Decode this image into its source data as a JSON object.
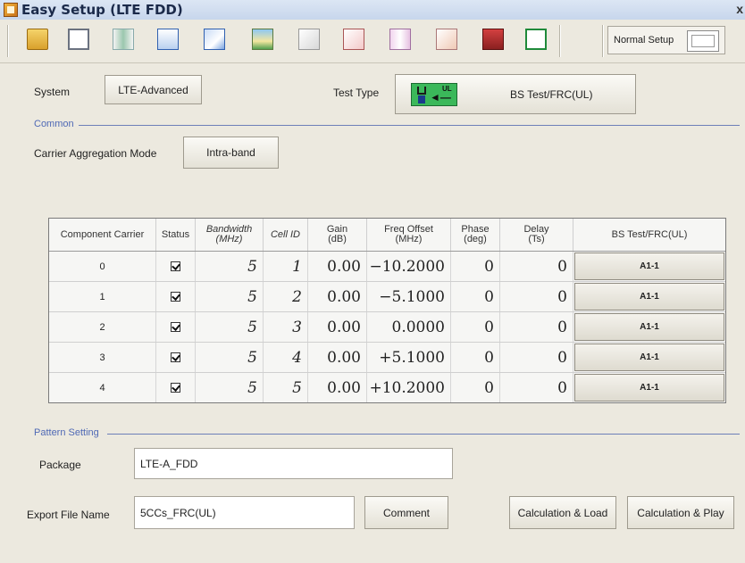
{
  "window": {
    "title": "Easy Setup (LTE FDD)",
    "close": "x"
  },
  "toolbar": {
    "icons": [
      "open-folder-icon",
      "save-icon",
      "waveform-icon",
      "export-icon",
      "load-play-icon",
      "landscape-icon",
      "ccdf-icon",
      "fft-icon",
      "time-domain-icon",
      "constellation-icon",
      "calculator-icon",
      "exit-icon"
    ],
    "normal_setup_label": "Normal Setup"
  },
  "system": {
    "label": "System",
    "value": "LTE-Advanced"
  },
  "test_type": {
    "label": "Test Type",
    "value": "BS Test/FRC(UL)",
    "icon_badge": "UL"
  },
  "common": {
    "section_title": "Common",
    "ca_mode_label": "Carrier Aggregation Mode",
    "ca_mode_value": "Intra-band"
  },
  "table": {
    "headers": {
      "component_carrier": "Component Carrier",
      "status": "Status",
      "bandwidth": "Bandwidth",
      "bandwidth_unit": "(MHz)",
      "cell_id": "Cell ID",
      "gain": "Gain",
      "gain_unit": "(dB)",
      "freq_offset": "Freq Offset",
      "freq_offset_unit": "(MHz)",
      "phase": "Phase",
      "phase_unit": "(deg)",
      "delay": "Delay",
      "delay_unit": "(Ts)",
      "bs_test": "BS Test/FRC(UL)"
    },
    "rows": [
      {
        "cc": "0",
        "status": true,
        "bandwidth": "5",
        "cell_id": "1",
        "gain": "0.00",
        "freq_offset": "−10.2000",
        "phase": "0",
        "delay": "0",
        "frc": "A1-1"
      },
      {
        "cc": "1",
        "status": true,
        "bandwidth": "5",
        "cell_id": "2",
        "gain": "0.00",
        "freq_offset": "−5.1000",
        "phase": "0",
        "delay": "0",
        "frc": "A1-1"
      },
      {
        "cc": "2",
        "status": true,
        "bandwidth": "5",
        "cell_id": "3",
        "gain": "0.00",
        "freq_offset": "0.0000",
        "phase": "0",
        "delay": "0",
        "frc": "A1-1"
      },
      {
        "cc": "3",
        "status": true,
        "bandwidth": "5",
        "cell_id": "4",
        "gain": "0.00",
        "freq_offset": "+5.1000",
        "phase": "0",
        "delay": "0",
        "frc": "A1-1"
      },
      {
        "cc": "4",
        "status": true,
        "bandwidth": "5",
        "cell_id": "5",
        "gain": "0.00",
        "freq_offset": "+10.2000",
        "phase": "0",
        "delay": "0",
        "frc": "A1-1"
      }
    ]
  },
  "pattern": {
    "section_title": "Pattern Setting",
    "package_label": "Package",
    "package_value": "LTE-A_FDD",
    "export_label": "Export File Name",
    "export_value": "5CCs_FRC(UL)",
    "comment_button": "Comment",
    "calc_load_button": "Calculation & Load",
    "calc_play_button": "Calculation & Play"
  },
  "colors": {
    "section_accent": "#4f69b5",
    "status_ok": "#3bb85a"
  }
}
